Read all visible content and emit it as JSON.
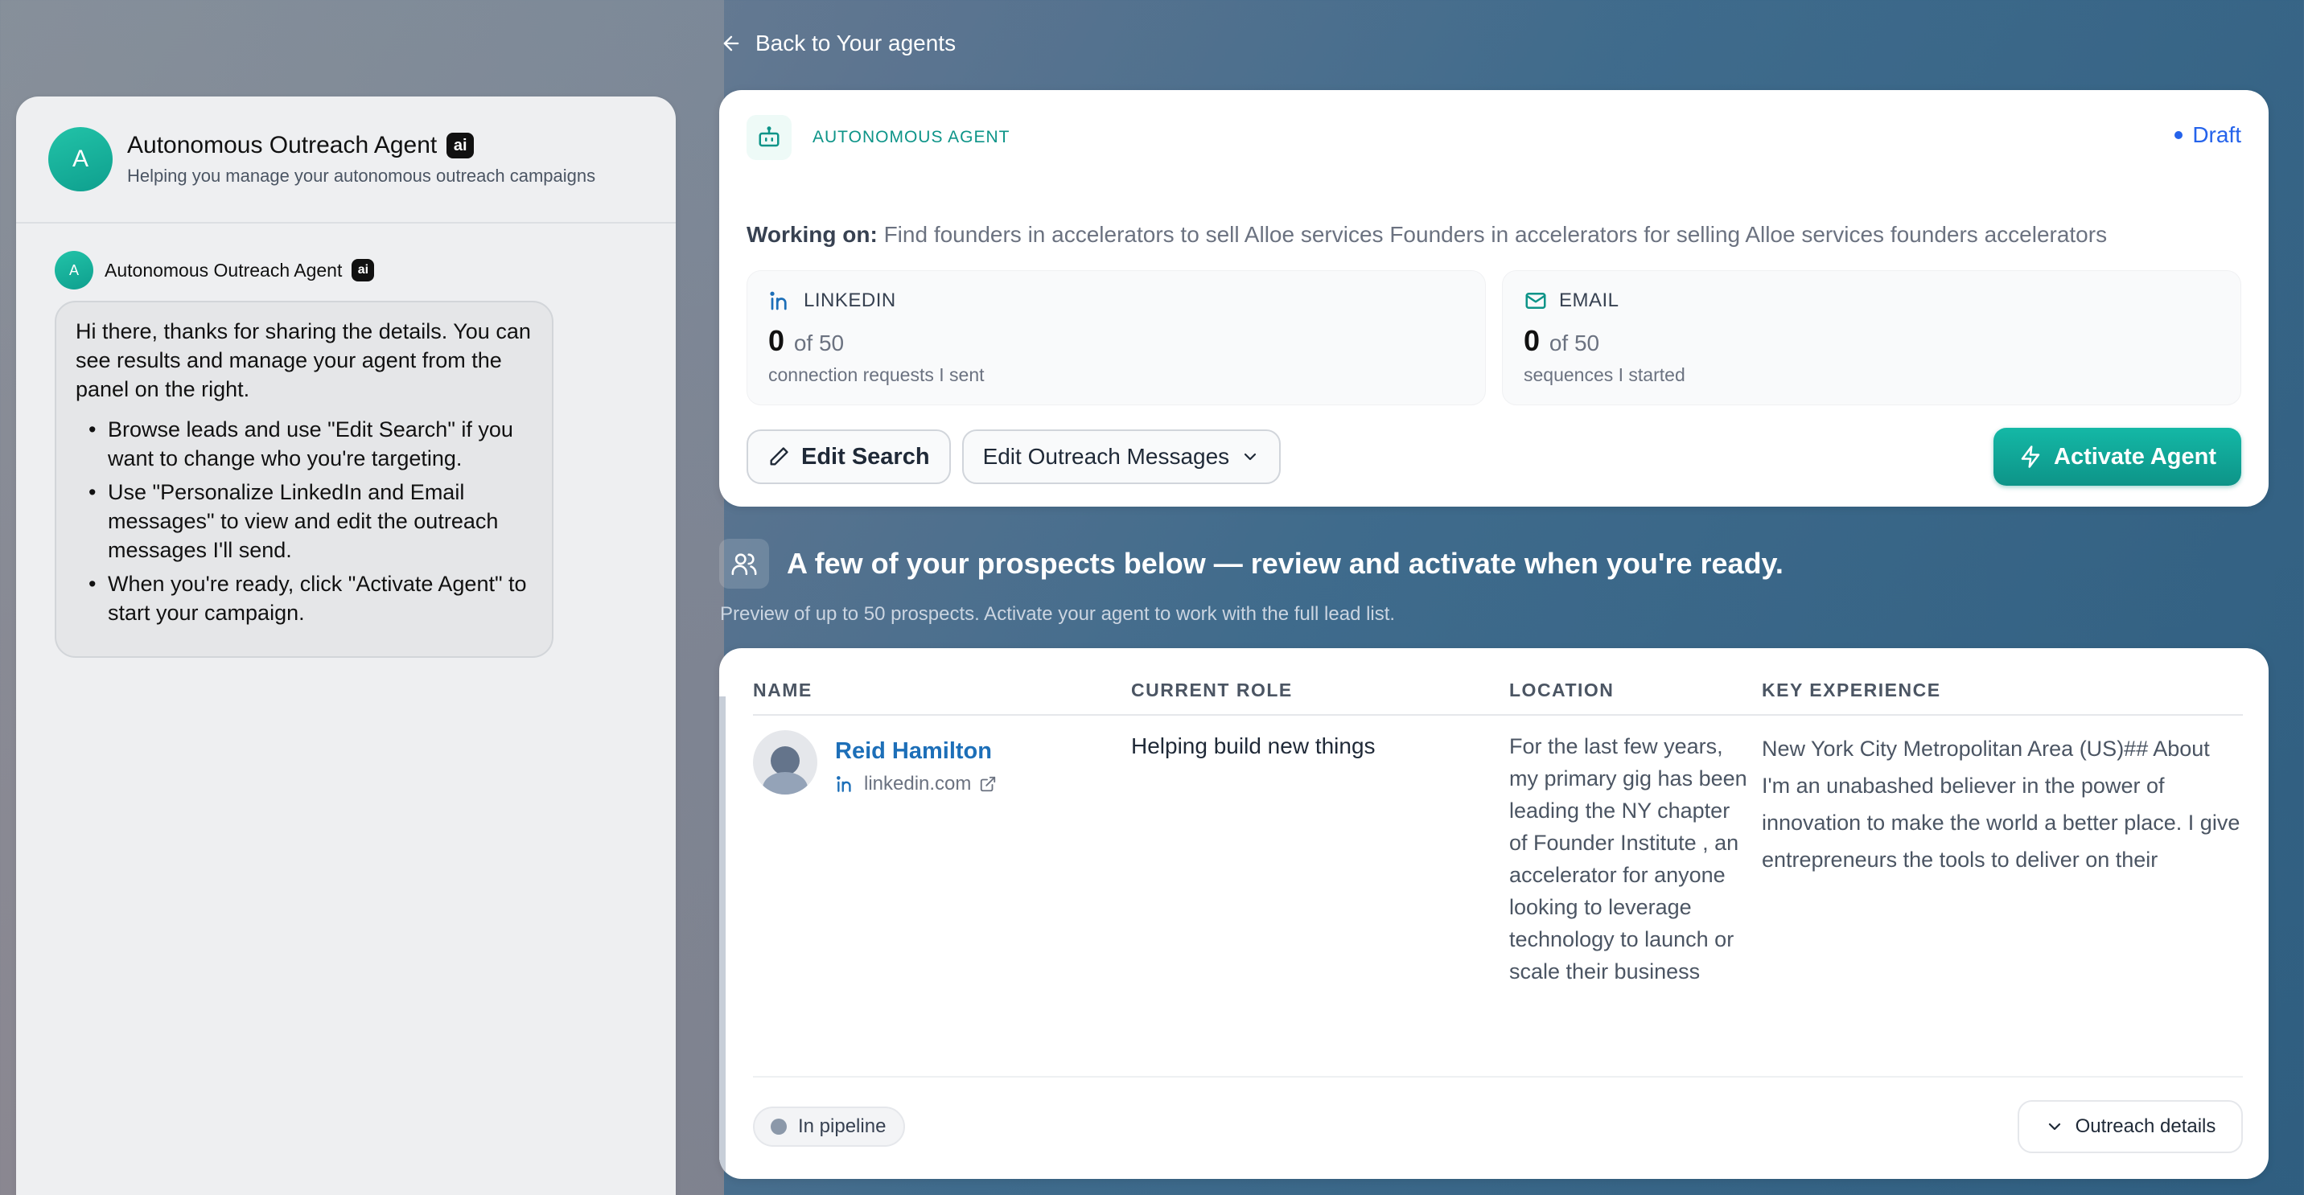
{
  "chat": {
    "avatar_letter": "A",
    "title": "Autonomous Outreach Agent",
    "ai_badge": "ai",
    "subtitle": "Helping you manage your autonomous outreach campaigns",
    "message": {
      "sender": "Autonomous Outreach Agent",
      "avatar_letter": "A",
      "intro": "Hi there, thanks for sharing the details. You can see results and manage your agent from the panel on the right.",
      "bullets": [
        "Browse leads and use \"Edit Search\" if you want to change who you're targeting.",
        "Use \"Personalize LinkedIn and Email messages\" to view and edit the outreach messages I'll send.",
        "When you're ready, click \"Activate Agent\" to start your campaign."
      ]
    }
  },
  "nav": {
    "back_label": "Back to Your agents"
  },
  "agent": {
    "type_label": "AUTONOMOUS AGENT",
    "status": "Draft",
    "working_label": "Working on:",
    "working_text": "Find founders in accelerators to sell Alloe services Founders in accelerators for selling Alloe services founders accelerators",
    "stats": [
      {
        "label": "LINKEDIN",
        "value": "0",
        "of": "of 50",
        "desc": "connection requests I sent",
        "icon": "linkedin-icon"
      },
      {
        "label": "EMAIL",
        "value": "0",
        "of": "of 50",
        "desc": "sequences I started",
        "icon": "mail-icon"
      }
    ],
    "edit_search_label": "Edit Search",
    "edit_outreach_label": "Edit Outreach Messages",
    "activate_label": "Activate Agent"
  },
  "prospects": {
    "title": "A few of your prospects below — review and activate when you're ready.",
    "subtitle": "Preview of up to 50 prospects. Activate your agent to work with the full lead list.",
    "columns": [
      "NAME",
      "CURRENT ROLE",
      "LOCATION",
      "KEY EXPERIENCE"
    ],
    "rows": [
      {
        "name": "Reid Hamilton",
        "link": "linkedin.com",
        "role": "Helping build new things",
        "location": "For the last few years, my primary gig has been leading the NY chapter of Founder Institute , an accelerator for anyone looking to leverage technology to launch or scale their business",
        "experience": "New York City Metropolitan Area (US)## About I'm an unabashed believer in the power of innovation to make the world a better place. I give entrepreneurs the tools to deliver on their",
        "status": "In pipeline",
        "details_label": "Outreach details"
      }
    ]
  },
  "colors": {
    "accent": "#0d9488",
    "draft": "#2563eb",
    "link": "#1d6fb8"
  }
}
